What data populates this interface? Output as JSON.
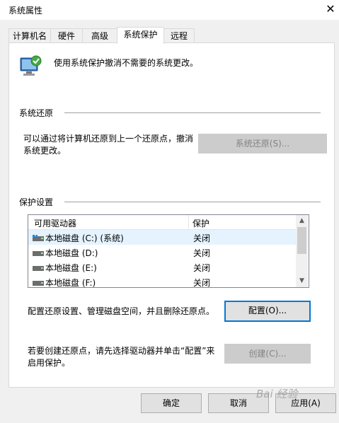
{
  "window": {
    "title": "系统属性",
    "close_symbol": "✕"
  },
  "tabs": [
    {
      "label": "计算机名"
    },
    {
      "label": "硬件"
    },
    {
      "label": "高级"
    },
    {
      "label": "系统保护"
    },
    {
      "label": "远程"
    }
  ],
  "intro_text": "使用系统保护撤消不需要的系统更改。",
  "restore": {
    "section_title": "系统还原",
    "description_line1": "可以通过将计算机还原到上一个还原点，撤消",
    "description_line2": "系统更改。",
    "button_label": "系统还原(S)..."
  },
  "protection": {
    "section_title": "保护设置",
    "columns": [
      "可用驱动器",
      "保护"
    ],
    "drives": [
      {
        "name": "本地磁盘 (C:) (系统)",
        "protection": "关闭",
        "icon": "system-drive-icon"
      },
      {
        "name": "本地磁盘 (D:)",
        "protection": "关闭",
        "icon": "drive-icon"
      },
      {
        "name": "本地磁盘 (E:)",
        "protection": "关闭",
        "icon": "drive-icon"
      },
      {
        "name": "本地磁盘 (F:)",
        "protection": "关闭",
        "icon": "drive-icon"
      }
    ],
    "configure_text": "配置还原设置、管理磁盘空间，并且删除还原点。",
    "configure_button": "配置(O)...",
    "create_text_line1": "若要创建还原点，请先选择驱动器并单击“配置”来",
    "create_text_line2": "启用保护。",
    "create_button": "创建(C)..."
  },
  "footer": {
    "ok": "确定",
    "cancel": "取消",
    "apply": "应用(A)"
  },
  "watermark": "Bai 经验",
  "colors": {
    "accent": "#0078d7",
    "selected_row": "#e5f3ff",
    "window_bg": "#f0f0f0"
  }
}
